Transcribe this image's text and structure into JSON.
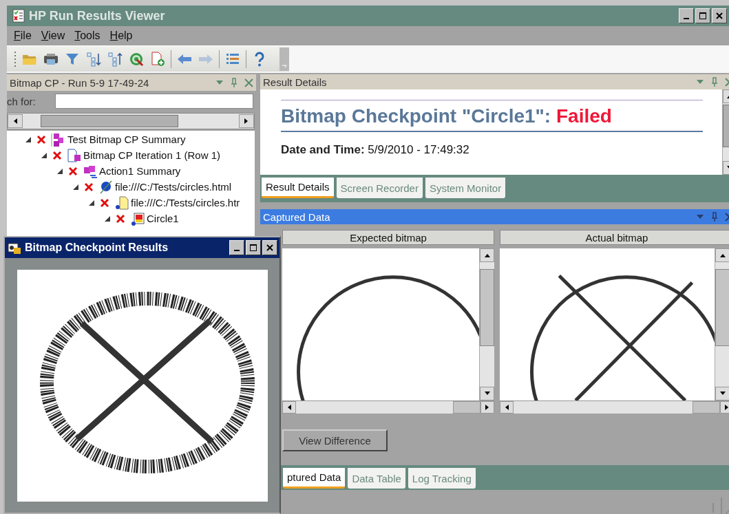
{
  "window": {
    "title": "HP Run Results Viewer"
  },
  "menu": [
    {
      "label": "File"
    },
    {
      "label": "View"
    },
    {
      "label": "Tools"
    },
    {
      "label": "Help"
    }
  ],
  "toolbar": [
    {
      "kind": "folder",
      "disabled": false
    },
    {
      "kind": "printer",
      "disabled": false
    },
    {
      "kind": "filter",
      "disabled": false
    },
    {
      "kind": "sort-down",
      "disabled": false
    },
    {
      "kind": "sort-up",
      "disabled": false
    },
    {
      "kind": "target",
      "disabled": false
    },
    {
      "kind": "doc-add",
      "disabled": false
    },
    {
      "kind": "separator"
    },
    {
      "kind": "back",
      "disabled": false
    },
    {
      "kind": "forward",
      "disabled": true
    },
    {
      "kind": "separator"
    },
    {
      "kind": "list",
      "disabled": false
    },
    {
      "kind": "separator"
    },
    {
      "kind": "help",
      "disabled": false
    }
  ],
  "tree_panel": {
    "title": "Bitmap CP - Run 5-9 17-49-24",
    "search_label": "ch for:"
  },
  "tree": [
    {
      "label": "Test Bitmap CP Summary",
      "kind": "test",
      "failed": true,
      "expanded": true,
      "children": [
        {
          "label": "Bitmap CP Iteration 1 (Row 1)",
          "kind": "iteration",
          "failed": true,
          "expanded": true,
          "children": [
            {
              "label": "Action1 Summary",
              "kind": "action",
              "failed": true,
              "expanded": true,
              "children": [
                {
                  "label": "file:///C:/Tests/circles.html",
                  "kind": "browser",
                  "failed": true,
                  "expanded": true,
                  "children": [
                    {
                      "label": "file:///C:/Tests/circles.htr",
                      "kind": "page",
                      "failed": true,
                      "expanded": true,
                      "children": [
                        {
                          "label": "Circle1",
                          "kind": "checkpoint",
                          "failed": true,
                          "expanded": true
                        }
                      ]
                    }
                  ]
                }
              ]
            }
          ]
        }
      ]
    }
  ],
  "result_details": {
    "title": "Result Details",
    "heading": "Bitmap Checkpoint \"Circle1\":",
    "status": "Failed",
    "date_label": "Date and Time:",
    "date_value": "5/9/2010 - 17:49:32"
  },
  "detail_tabs": [
    {
      "label": "Result Details",
      "selected": true
    },
    {
      "label": "Screen Recorder",
      "selected": false
    },
    {
      "label": "System Monitor",
      "selected": false
    }
  ],
  "captured": {
    "title": "Captured Data",
    "expected_label": "Expected bitmap",
    "actual_label": "Actual bitmap",
    "button": "View Difference"
  },
  "bottom_tabs": [
    {
      "label": "ptured Data",
      "selected": true
    },
    {
      "label": "Data Table",
      "selected": false
    },
    {
      "label": "Log Tracking",
      "selected": false
    }
  ],
  "popup": {
    "title": "Bitmap Checkpoint Results"
  }
}
